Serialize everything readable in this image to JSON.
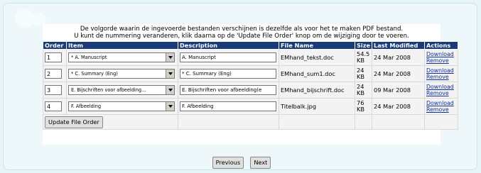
{
  "notice": {
    "line1": "De volgorde waarin de ingevoerde bestanden verschijnen is dezelfde als voor het te maken PDF bestand.",
    "line2": "U kunt de nummering veranderen, klik daarna op de 'Update File Order' knop om de wijziging door te voeren."
  },
  "table": {
    "headers": {
      "order": "Order",
      "item": "Item",
      "description": "Description",
      "file_name": "File Name",
      "size": "Size",
      "last_modified": "Last Modified",
      "actions": "Actions"
    },
    "rows": [
      {
        "order": "1",
        "item": "* A. Manuscript",
        "description": "A. Manuscript",
        "file_name": "EMhand_tekst.doc",
        "size_value": "54.5",
        "size_unit": "KB",
        "last_modified": "24 Mar 2008",
        "download": "Download",
        "remove": "Remove"
      },
      {
        "order": "2",
        "item": "* C. Summary (Eng)",
        "description": "* C. Summary (Eng)",
        "file_name": "EMhand_sum1.doc",
        "size_value": "24",
        "size_unit": "KB",
        "last_modified": "24 Mar 2008",
        "download": "Download",
        "remove": "Remove"
      },
      {
        "order": "3",
        "item": "E. Bijschriften voor afbeelding...",
        "description": "E. Bijschriften voor afbeelding(e",
        "file_name": "EMhand_bijschrift.doc",
        "size_value": "24",
        "size_unit": "KB",
        "last_modified": "09 Mar 2008",
        "download": "Download",
        "remove": "Remove"
      },
      {
        "order": "4",
        "item": "F. Afbeelding",
        "description": "F. Afbeelding",
        "file_name": "Titelbalk.jpg",
        "size_value": "76",
        "size_unit": "KB",
        "last_modified": "24 Mar 2008",
        "download": "Download",
        "remove": "Remove"
      }
    ]
  },
  "buttons": {
    "update_order": "Update File Order",
    "previous": "Previous",
    "next": "Next"
  },
  "colors": {
    "header_bg": "#1a3b7a",
    "page_bg": "#e7f4f8",
    "link": "#1030a0"
  }
}
